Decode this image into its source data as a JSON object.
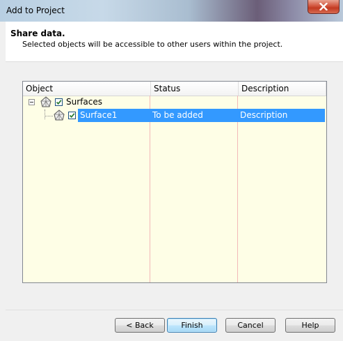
{
  "window": {
    "title": "Add to Project"
  },
  "header": {
    "title": "Share data.",
    "subtitle": "Selected objects will be accessible to other users within the project."
  },
  "grid": {
    "columns": [
      "Object",
      "Status",
      "Description"
    ],
    "rows": [
      {
        "object": "Surfaces",
        "status": "",
        "description": "",
        "checked": true,
        "expanded": true,
        "selected": false,
        "level": 0
      },
      {
        "object": "Surface1",
        "status": "To be added",
        "description": "Description",
        "checked": true,
        "expanded": false,
        "selected": true,
        "level": 1
      }
    ]
  },
  "buttons": {
    "back": "< Back",
    "finish": "Finish",
    "cancel": "Cancel",
    "help": "Help"
  },
  "icons": {
    "close": "close-icon",
    "surface": "surface-icon",
    "expander": "collapse-icon",
    "checkbox": "checkbox-checked-icon"
  },
  "colors": {
    "selection": "#3399ff",
    "grid_background": "#fefee6",
    "close_button": "#c7432b"
  }
}
